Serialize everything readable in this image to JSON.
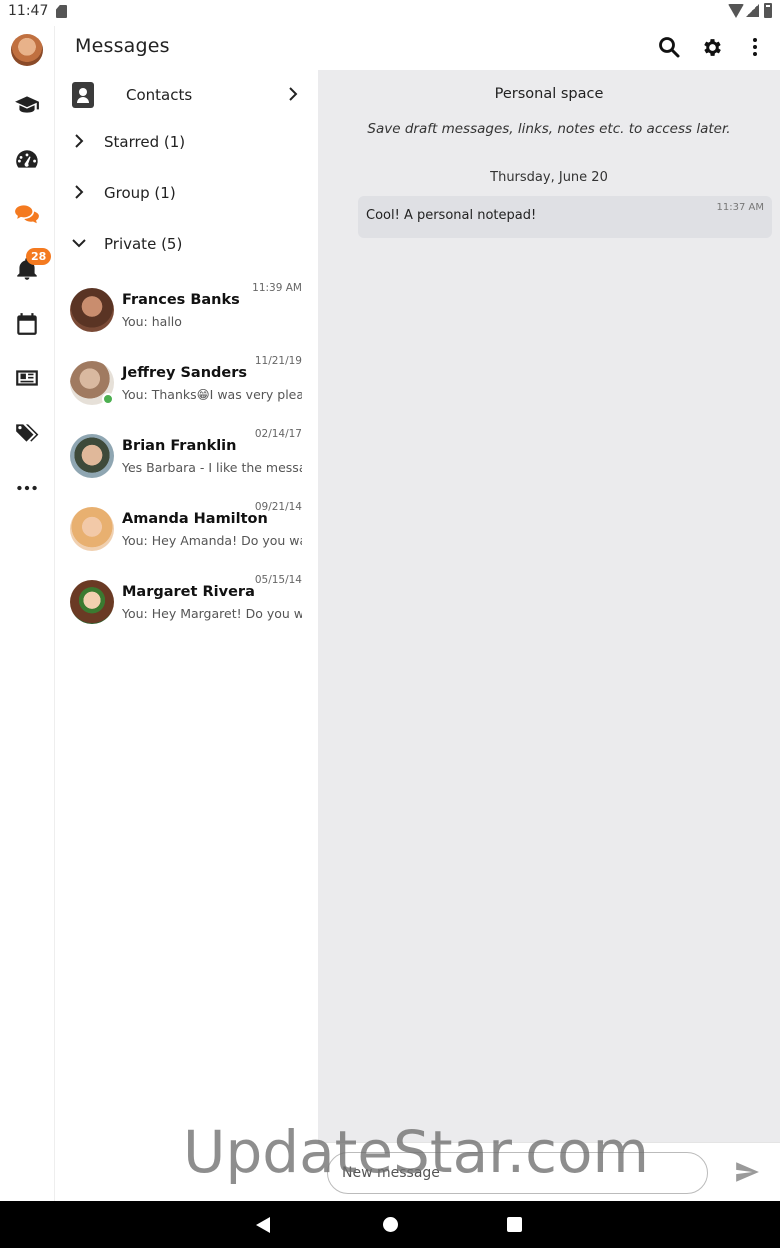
{
  "status_bar": {
    "time": "11:47"
  },
  "app": {
    "title": "Messages"
  },
  "rail": {
    "notification_badge": "28",
    "active_color": "#f47a20"
  },
  "list": {
    "contacts_label": "Contacts",
    "sections": [
      {
        "label": "Starred (1)",
        "expanded": false
      },
      {
        "label": "Group (1)",
        "expanded": false
      },
      {
        "label": "Private (5)",
        "expanded": true
      }
    ],
    "chats": [
      {
        "name": "Frances Banks",
        "date": "11:39 AM",
        "preview": "You: hallo",
        "online": false
      },
      {
        "name": "Jeffrey Sanders",
        "date": "11/21/19",
        "preview": "You: Thanks😁I was very pleased",
        "online": true
      },
      {
        "name": "Brian Franklin",
        "date": "02/14/17",
        "preview": "Yes Barbara - I like the message",
        "online": false
      },
      {
        "name": "Amanda Hamilton",
        "date": "09/21/14",
        "preview": "You: Hey Amanda! Do you want",
        "online": false
      },
      {
        "name": "Margaret Rivera",
        "date": "05/15/14",
        "preview": "You: Hey Margaret! Do you want",
        "online": false
      }
    ]
  },
  "conversation": {
    "title": "Personal space",
    "subtitle": "Save draft messages, links, notes etc. to access later.",
    "date_separator": "Thursday, June 20",
    "messages": [
      {
        "text": "Cool! A personal notepad!",
        "time": "11:37 AM"
      }
    ]
  },
  "composer": {
    "placeholder": "New message"
  },
  "watermark": "UpdateStar.com"
}
